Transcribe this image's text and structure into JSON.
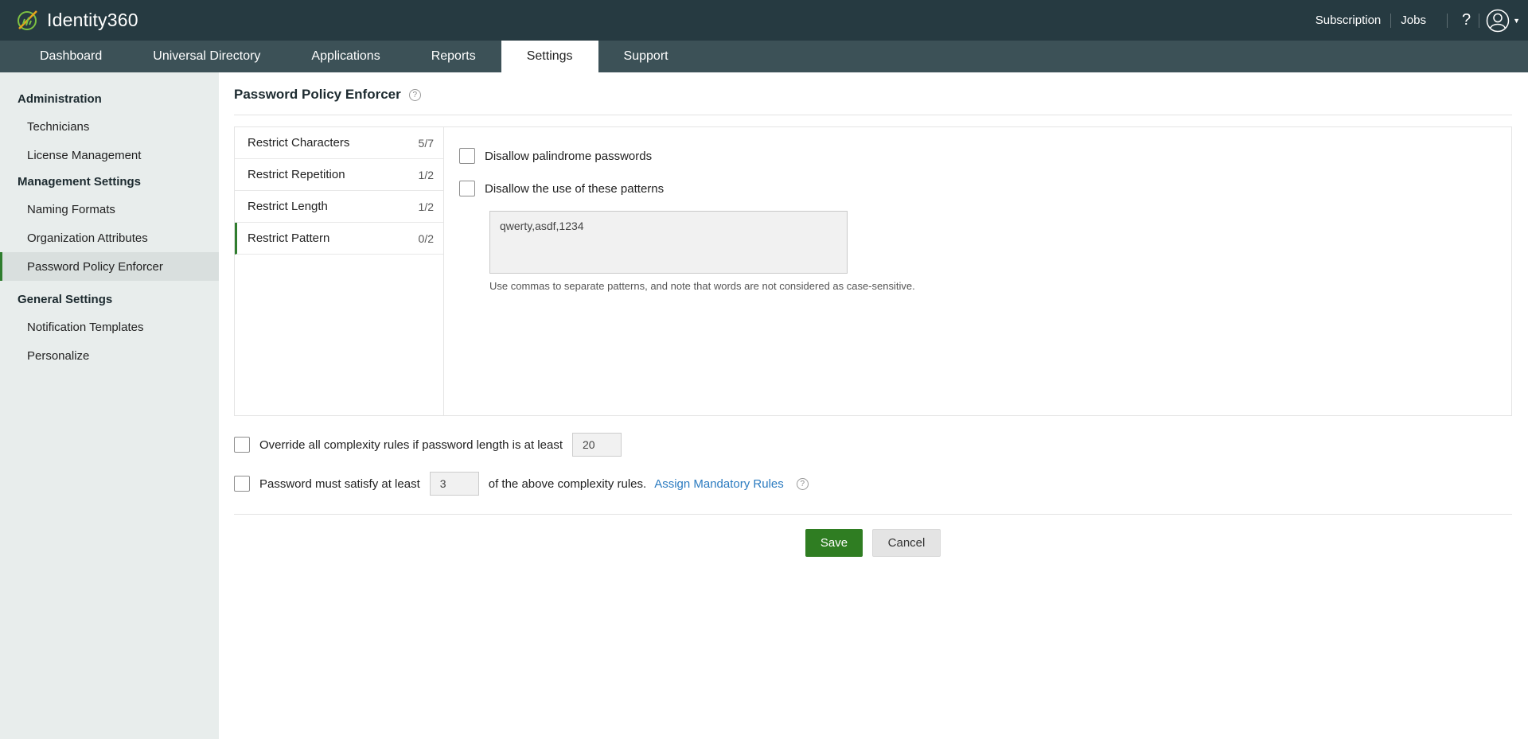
{
  "app": {
    "name": "Identity360"
  },
  "topbar": {
    "subscription": "Subscription",
    "jobs": "Jobs",
    "help": "?"
  },
  "nav": {
    "tabs": [
      "Dashboard",
      "Universal Directory",
      "Applications",
      "Reports",
      "Settings",
      "Support"
    ],
    "active": "Settings"
  },
  "sidebar": {
    "sections": [
      {
        "title": "Administration",
        "items": [
          "Technicians",
          "License Management"
        ]
      },
      {
        "title": "Management Settings",
        "items": [
          "Naming Formats",
          "Organization Attributes",
          "Password Policy Enforcer"
        ]
      },
      {
        "title": "General Settings",
        "items": [
          "Notification Templates",
          "Personalize"
        ]
      }
    ],
    "active_item": "Password Policy Enforcer"
  },
  "page": {
    "title": "Password Policy Enforcer",
    "help": "?"
  },
  "rules": [
    {
      "label": "Restrict Characters",
      "count": "5/7"
    },
    {
      "label": "Restrict Repetition",
      "count": "1/2"
    },
    {
      "label": "Restrict Length",
      "count": "1/2"
    },
    {
      "label": "Restrict Pattern",
      "count": "0/2"
    }
  ],
  "active_rule": "Restrict Pattern",
  "pattern_panel": {
    "palindrome_label": "Disallow palindrome passwords",
    "patterns_label": "Disallow the use of these patterns",
    "patterns_value": "qwerty,asdf,1234",
    "hint": "Use commas to separate patterns, and note that words are not considered as case-sensitive."
  },
  "options": {
    "override_label": "Override all complexity rules if password length is at least",
    "override_value": "20",
    "satisfy_label_pre": "Password must satisfy at least",
    "satisfy_value": "3",
    "satisfy_label_post": "of the above complexity rules.",
    "assign_link": "Assign Mandatory Rules",
    "help": "?"
  },
  "actions": {
    "save": "Save",
    "cancel": "Cancel"
  },
  "colors": {
    "topbar": "#263a41",
    "navbar": "#3c5157",
    "accent_green": "#2f7d22",
    "link_blue": "#2b7bc0",
    "sidebar_bg": "#e8edec"
  }
}
